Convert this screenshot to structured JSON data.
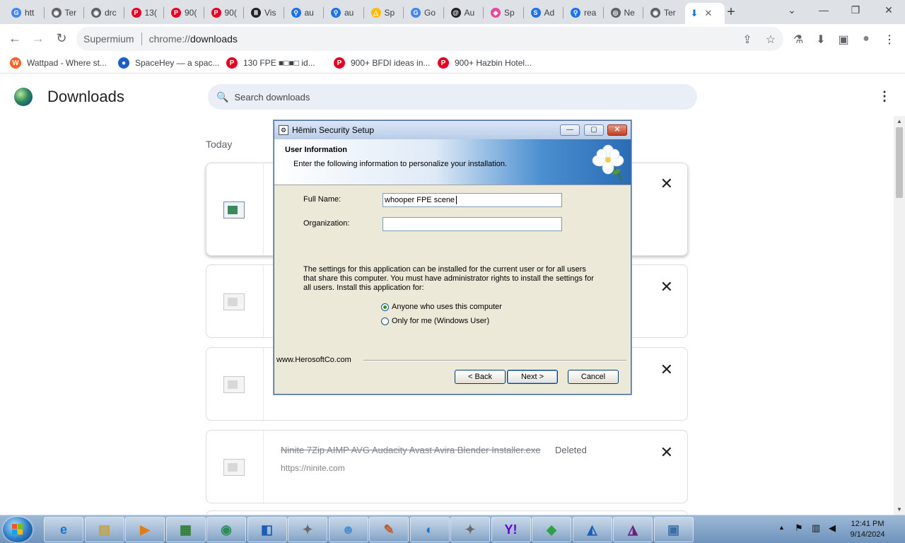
{
  "tabs": [
    {
      "label": "htt",
      "icon": "google-icon",
      "color": "#4285f4",
      "glyph": "G"
    },
    {
      "label": "Ter",
      "icon": "globe-icon",
      "color": "#5f6368",
      "glyph": "◉"
    },
    {
      "label": "drc",
      "icon": "globe-icon",
      "color": "#5f6368",
      "glyph": "◉"
    },
    {
      "label": "13(",
      "icon": "pinterest-icon",
      "color": "#e60023",
      "glyph": "P"
    },
    {
      "label": "90(",
      "icon": "pinterest-icon",
      "color": "#e60023",
      "glyph": "P"
    },
    {
      "label": "90(",
      "icon": "pinterest-icon",
      "color": "#e60023",
      "glyph": "P"
    },
    {
      "label": "Vis",
      "icon": "museum-icon",
      "color": "#202124",
      "glyph": "Ⅲ"
    },
    {
      "label": "au",
      "icon": "search-icon",
      "color": "#1a73e8",
      "glyph": "⚲"
    },
    {
      "label": "au",
      "icon": "search-icon",
      "color": "#1a73e8",
      "glyph": "⚲"
    },
    {
      "label": "Sp",
      "icon": "drive-icon",
      "color": "#fbbc04",
      "glyph": "△"
    },
    {
      "label": "Go",
      "icon": "google-icon",
      "color": "#4285f4",
      "glyph": "G"
    },
    {
      "label": "Au",
      "icon": "at-icon",
      "color": "#202124",
      "glyph": "@"
    },
    {
      "label": "Sp",
      "icon": "cube-icon",
      "color": "#e8479c",
      "glyph": "◈"
    },
    {
      "label": "Ad",
      "icon": "s-icon",
      "color": "#1a73e8",
      "glyph": "S"
    },
    {
      "label": "rea",
      "icon": "search-icon",
      "color": "#1a73e8",
      "glyph": "⚲"
    },
    {
      "label": "Ne",
      "icon": "chrome-icon",
      "color": "#5f6368",
      "glyph": "◎"
    },
    {
      "label": "Ter",
      "icon": "globe-icon",
      "color": "#5f6368",
      "glyph": "◉"
    }
  ],
  "active_tab": {
    "icon": "download-icon",
    "glyph": "⬇",
    "close": "✕"
  },
  "new_tab": "+",
  "window_controls": {
    "list": "⌄",
    "minimize": "—",
    "restore": "❐",
    "close": "✕"
  },
  "toolbar": {
    "back": "←",
    "forward": "→",
    "reload": "↻",
    "brand": "Supermium",
    "url_scheme": "chrome://",
    "url_path": "downloads",
    "share": "⇪",
    "star": "☆",
    "extension": "⚗",
    "download": "⬇",
    "sidepanel": "▣",
    "profile": "●",
    "menu": "⋮"
  },
  "bookmarks": [
    {
      "label": "Wattpad - Where st...",
      "icon": "wattpad-icon",
      "color": "#ff6122",
      "glyph": "W"
    },
    {
      "label": "SpaceHey — a spac...",
      "icon": "spacehey-icon",
      "color": "#1e5fc4",
      "glyph": "●"
    },
    {
      "label": "130 FPE ■□■□ id...",
      "icon": "pinterest-icon",
      "color": "#e60023",
      "glyph": "P"
    },
    {
      "label": "900+ BFDI ideas in...",
      "icon": "pinterest-icon",
      "color": "#e60023",
      "glyph": "P"
    },
    {
      "label": "900+ Hazbin Hotel...",
      "icon": "pinterest-icon",
      "color": "#e60023",
      "glyph": "P"
    }
  ],
  "downloads": {
    "title": "Downloads",
    "search_placeholder": "Search downloads",
    "search_icon": "🔍",
    "menu": "⋮",
    "section": "Today",
    "remove_glyph": "✕",
    "last_item": {
      "filename": "Ninite 7Zip AIMP AVG Audacity Avast Avira Blender Installer.exe",
      "status": "Deleted",
      "url": "https://ninite.com"
    }
  },
  "dialog": {
    "title": "Hēmin Security Setup",
    "header_title": "User Information",
    "header_subtitle": "Enter the following information to personalize your installation.",
    "full_name_label": "Full Name:",
    "full_name_value": "whooper FPE scene",
    "organization_label": "Organization:",
    "organization_value": "",
    "description": "The settings for this application can be installed for the current user or for all users that share this computer. You must have administrator rights to install the settings for all users. Install this application for:",
    "radio_all": "Anyone who uses this computer",
    "radio_me": "Only for me (Windows User)",
    "selected": "all",
    "website": "www.HerosoftCo.com",
    "back": "< Back",
    "next": "Next >",
    "cancel": "Cancel",
    "btn_min": "—",
    "btn_max": "▢",
    "btn_close": "✕"
  },
  "taskbar": {
    "apps": [
      {
        "icon": "ie-icon",
        "glyph": "e",
        "color": "#1e73c8"
      },
      {
        "icon": "folder-icon",
        "glyph": "▤",
        "color": "#c9a227"
      },
      {
        "icon": "media-player-icon",
        "glyph": "▶",
        "color": "#e07b1a"
      },
      {
        "icon": "app-icon",
        "glyph": "▦",
        "color": "#2e7d32"
      },
      {
        "icon": "globe-icon",
        "glyph": "◉",
        "color": "#2e8b57"
      },
      {
        "icon": "app-icon",
        "glyph": "◧",
        "color": "#1a5fb4"
      },
      {
        "icon": "wand-icon",
        "glyph": "✦",
        "color": "#6a6a6a"
      },
      {
        "icon": "users-icon",
        "glyph": "☻",
        "color": "#4a8fd0"
      },
      {
        "icon": "paint-icon",
        "glyph": "✎",
        "color": "#c05a2a"
      },
      {
        "icon": "edge-icon",
        "glyph": "◐",
        "color": "#0f78d4"
      },
      {
        "icon": "wand-icon",
        "glyph": "✦",
        "color": "#6a6a6a"
      },
      {
        "icon": "yahoo-icon",
        "glyph": "Y!",
        "color": "#6001d2"
      },
      {
        "icon": "bluestacks-icon",
        "glyph": "◆",
        "color": "#2ea043"
      },
      {
        "icon": "app-icon",
        "glyph": "◭",
        "color": "#1a5fb4"
      },
      {
        "icon": "visual-studio-icon",
        "glyph": "◮",
        "color": "#68217a"
      },
      {
        "icon": "network-icon",
        "glyph": "▣",
        "color": "#3a6ea5"
      }
    ],
    "tray": {
      "arrow": "▲",
      "flag": "⚑",
      "network": "▥",
      "volume": "◀"
    },
    "time": "12:41 PM",
    "date": "9/14/2024"
  }
}
